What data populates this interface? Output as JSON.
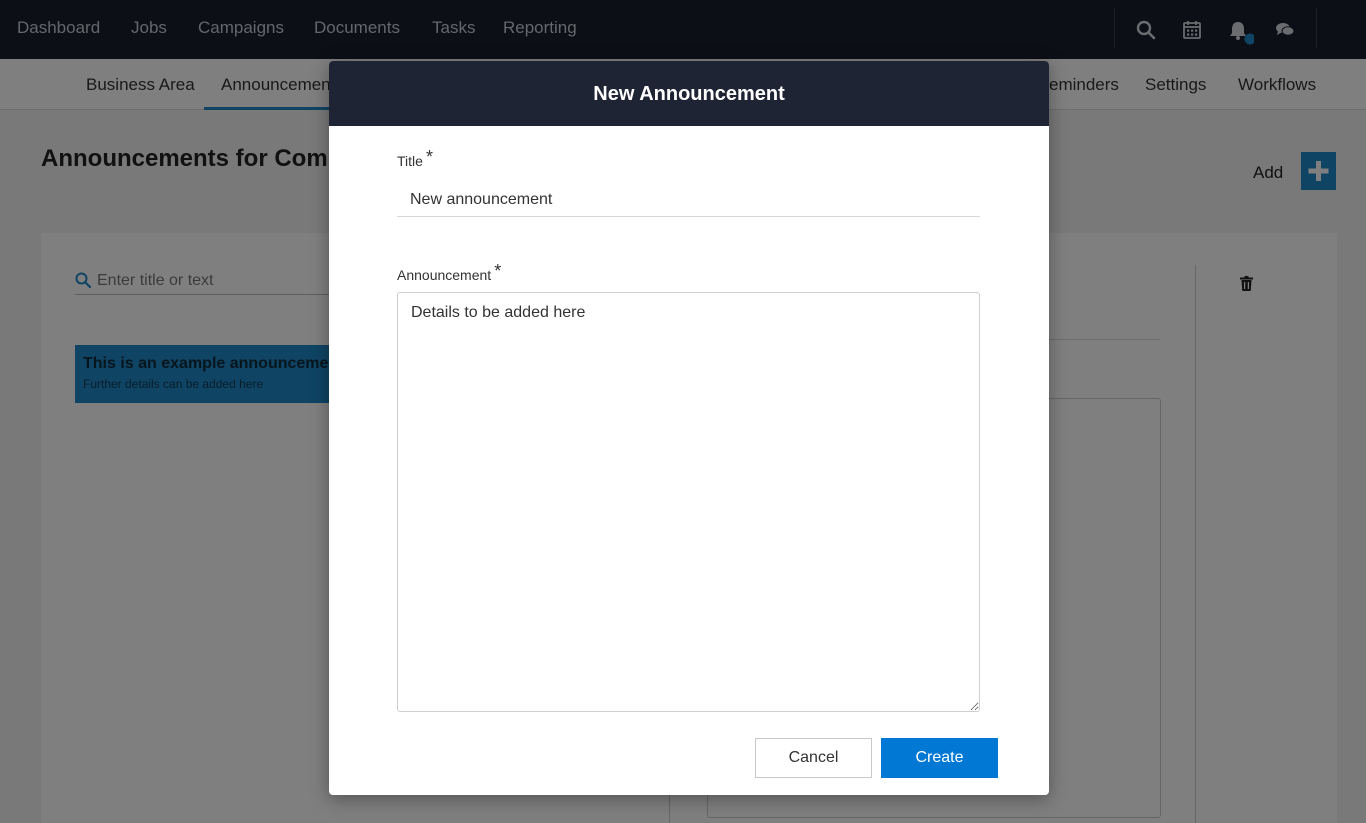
{
  "topnav": {
    "items": [
      "Dashboard",
      "Jobs",
      "Campaigns",
      "Documents",
      "Tasks",
      "Reporting"
    ],
    "icons": [
      "search-icon",
      "calendar-icon",
      "bell-icon",
      "chat-icon"
    ],
    "notification_color": "#1e88c8"
  },
  "subnav": {
    "items": [
      "Business Area",
      "Announcements",
      "Reminders",
      "Settings",
      "Workflows"
    ],
    "visible_items": [
      "Business Area",
      "Announcemen",
      "eminders",
      "Settings",
      "Workflows"
    ],
    "active_item": "Announcements"
  },
  "page": {
    "title": "Announcements for Com",
    "add_label": "Add",
    "search_placeholder": "Enter title or text",
    "list": [
      {
        "title": "This is an example announceme",
        "subtitle": "Further details can be added here"
      }
    ]
  },
  "modal": {
    "header_title": "New Announcement",
    "title_label": "Title",
    "title_value": "New announcement",
    "announcement_label": "Announcement",
    "announcement_value": "Details to be added here",
    "required_marker": "*",
    "cancel_label": "Cancel",
    "create_label": "Create"
  },
  "colors": {
    "topbar": "#1a1f2e",
    "modal_header": "#1f2434",
    "accent": "#1e88c8",
    "primary_button": "#0078d4"
  }
}
